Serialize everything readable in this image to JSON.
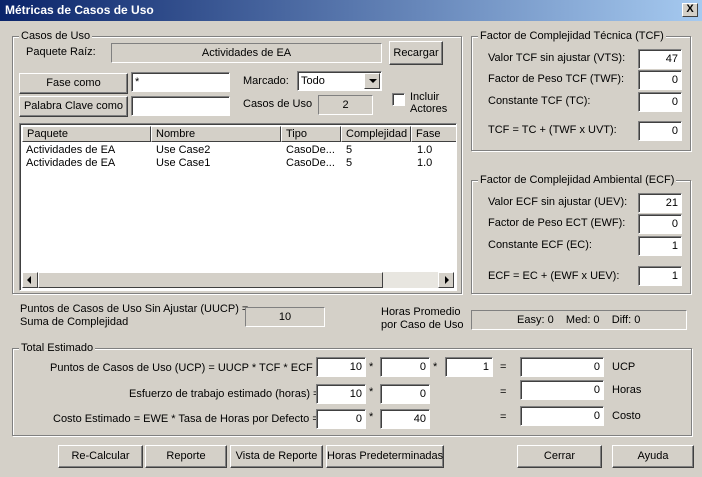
{
  "window": {
    "title": "Métricas de Casos de Uso",
    "close": "X"
  },
  "casos": {
    "legend": "Casos de Uso",
    "paquete_label": "Paquete Raíz:",
    "paquete_value": "Actividades de EA",
    "recargar": "Recargar",
    "fase_button": "Fase como",
    "fase_value": "*",
    "palabra_button": "Palabra Clave como",
    "palabra_value": "",
    "marcado_label": "Marcado:",
    "marcado_value": "Todo",
    "incluir_label_1": "Incluir",
    "incluir_label_2": "Actores",
    "count_label": "Casos de Uso",
    "count_value": "2",
    "columns": [
      "Paquete",
      "Nombre",
      "Tipo",
      "Complejidad",
      "Fase"
    ],
    "rows": [
      [
        "Actividades de EA",
        "Use Case2",
        "CasoDe...",
        "5",
        "1.0"
      ],
      [
        "Actividades de EA",
        "Use Case1",
        "CasoDe...",
        "5",
        "1.0"
      ]
    ]
  },
  "uucp": {
    "label_1": "Puntos de Casos de Uso Sin Ajustar (UUCP) =",
    "label_2": "Suma de Complejidad",
    "value": "10",
    "horas_label_1": "Horas Promedio",
    "horas_label_2": "por Caso de Uso",
    "easy": "Easy: 0",
    "med": "Med: 0",
    "diff": "Diff: 0"
  },
  "tcf": {
    "legend": "Factor de Complejidad Técnica (TCF)",
    "vts_label": "Valor TCF sin ajustar (VTS):",
    "vts_value": "47",
    "twf_label": "Factor de Peso TCF (TWF):",
    "twf_value": "0",
    "tc_label": "Constante TCF (TC):",
    "tc_value": "0",
    "formula_label": "TCF = TC + (TWF x UVT):",
    "formula_value": "0"
  },
  "ecf": {
    "legend": "Factor de Complejidad Ambiental (ECF)",
    "uev_label": "Valor ECF sin ajustar (UEV):",
    "uev_value": "21",
    "ewf_label": "Factor de Peso ECT (EWF):",
    "ewf_value": "0",
    "ec_label": "Constante ECF (EC):",
    "ec_value": "1",
    "formula_label": "ECF  = EC + (EWF x UEV):",
    "formula_value": "1"
  },
  "total": {
    "legend": "Total Estimado",
    "ucp_label": "Puntos de Casos de Uso (UCP) = UUCP * TCF * ECF =",
    "ucp_a": "10",
    "ucp_b": "0",
    "ucp_c": "1",
    "ucp_result": "0",
    "ucp_unit": "UCP",
    "esf_label": "Esfuerzo de trabajo estimado (horas) =",
    "esf_a": "10",
    "esf_b": "0",
    "esf_result": "0",
    "esf_unit": "Horas",
    "costo_label": "Costo Estimado = EWE * Tasa de Horas por Defecto =",
    "costo_a": "0",
    "costo_b": "40",
    "costo_result": "0",
    "costo_unit": "Costo",
    "mult": "*",
    "eq": "="
  },
  "buttons": {
    "recalcular": "Re-Calcular",
    "reporte": "Reporte",
    "vista": "Vista de Reporte",
    "horas": "Horas Predeterminadas",
    "cerrar": "Cerrar",
    "ayuda": "Ayuda"
  }
}
